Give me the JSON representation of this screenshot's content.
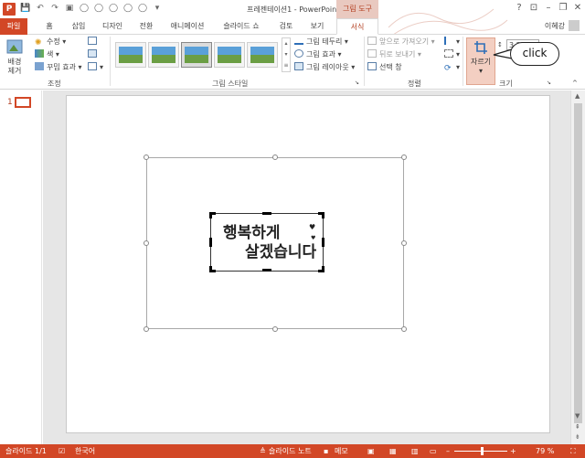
{
  "window": {
    "title": "프레젠테이션1 - PowerPoint",
    "context_group": "그림 도구",
    "controls": [
      "?",
      "⊡",
      "–",
      "❐",
      "✕"
    ],
    "app_logo": "P"
  },
  "user": {
    "name": "이혜강"
  },
  "tabs": [
    {
      "label": "파일",
      "name": "tab-file"
    },
    {
      "label": "홈",
      "name": "tab-home"
    },
    {
      "label": "삽입",
      "name": "tab-insert"
    },
    {
      "label": "디자인",
      "name": "tab-design"
    },
    {
      "label": "전환",
      "name": "tab-transitions"
    },
    {
      "label": "애니메이션",
      "name": "tab-animations"
    },
    {
      "label": "슬라이드 쇼",
      "name": "tab-slideshow"
    },
    {
      "label": "검토",
      "name": "tab-review"
    },
    {
      "label": "보기",
      "name": "tab-view"
    },
    {
      "label": "서식",
      "name": "tab-format"
    }
  ],
  "ribbon": {
    "adjust": {
      "label": "조정",
      "remove_bg": [
        "배경",
        "제거"
      ],
      "corrections": "수정",
      "color": "색",
      "artistic": "꾸밈 효과"
    },
    "picture_styles": {
      "label": "그림 스타일",
      "border": "그림 테두리",
      "effects": "그림 효과",
      "layout": "그림 레이아웃"
    },
    "arrange": {
      "label": "정렬",
      "bring_forward": "앞으로 가져오기",
      "send_backward": "뒤로 보내기",
      "selection_pane": "선택 창"
    },
    "size": {
      "label": "크기",
      "crop": "자르기",
      "height": "3.25 c"
    }
  },
  "callout": {
    "text": "click"
  },
  "slide": {
    "number": "1",
    "image_text_line1": "행복하게",
    "image_text_line2": "살겠습니다"
  },
  "status": {
    "slide": "슬라이드 1/1",
    "language": "한국어",
    "notes": "슬라이드 노트",
    "comments": "메모",
    "zoom": "79 %",
    "zoom_value": 0.79
  },
  "colors": {
    "accent": "#d24726",
    "context_bg": "#e9c9c0",
    "crop_highlight": "#f3cfc2"
  }
}
